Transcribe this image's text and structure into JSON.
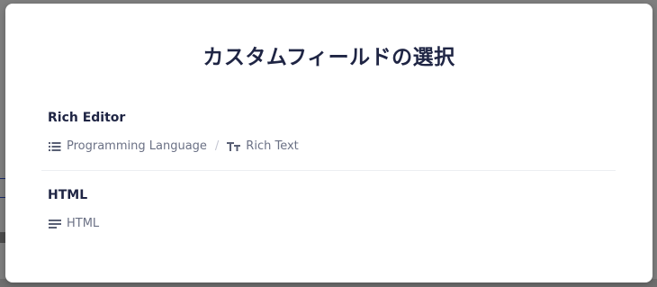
{
  "dialog": {
    "title": "カスタムフィールドの選択",
    "items": [
      {
        "title": "Rich Editor",
        "meta": [
          {
            "icon": "list-icon",
            "label": "Programming Language"
          },
          {
            "icon": "text-format-icon",
            "label": "Rich Text"
          }
        ],
        "separator": "/"
      },
      {
        "title": "HTML",
        "meta": [
          {
            "icon": "lines-icon",
            "label": "HTML"
          }
        ]
      }
    ]
  },
  "colors": {
    "overlay": "#7f7f7f",
    "modal_bg": "#ffffff",
    "title": "#1f2544",
    "meta_text": "#6b7185",
    "divider": "#eceef2"
  }
}
